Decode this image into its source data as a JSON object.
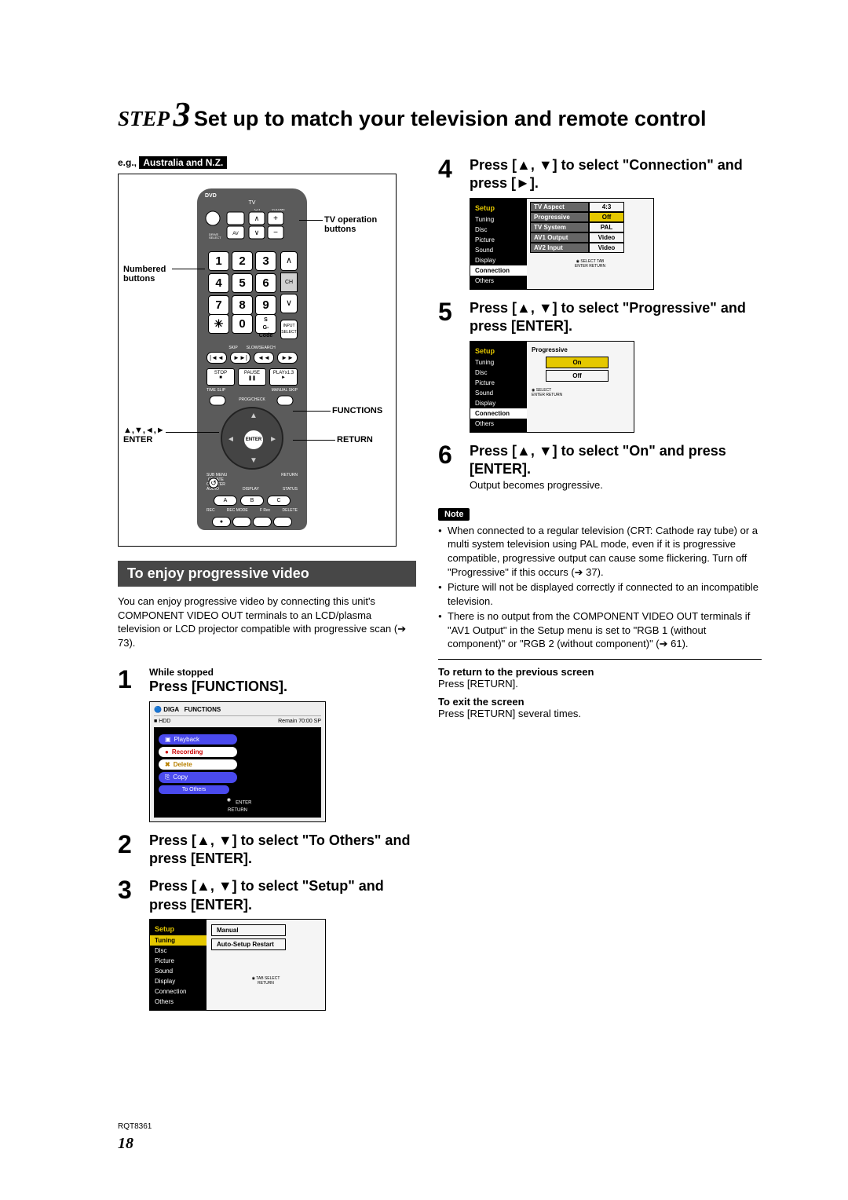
{
  "title": {
    "step_label": "STEP",
    "step_num": "3",
    "step_title": "Set up to match your television and remote control"
  },
  "eg": {
    "prefix": "e.g.,",
    "region": "Australia and N.Z."
  },
  "remote": {
    "dvd": "DVD",
    "tv": "TV",
    "keys": [
      "1",
      "2",
      "3",
      "4",
      "5",
      "6",
      "7",
      "8",
      "9"
    ],
    "zero": "0",
    "ch": "CH",
    "enter": "ENTER",
    "abc": [
      "A",
      "B",
      "C"
    ],
    "callouts": {
      "numbered": "Numbered buttons",
      "tvop": "TV operation buttons",
      "functions": "FUNCTIONS",
      "arrows": "▲,▼,◄,►\nENTER",
      "return": "RETURN"
    }
  },
  "section_bar": "To enjoy progressive video",
  "intro": "You can enjoy progressive video by connecting this unit's COMPONENT VIDEO OUT terminals to an LCD/plasma television or LCD projector compatible with progressive scan (➔ 73).",
  "steps": {
    "s1_small": "While stopped",
    "s1": "Press [FUNCTIONS].",
    "s2": "Press [▲, ▼] to select \"To Others\" and press [ENTER].",
    "s3": "Press [▲, ▼] to select \"Setup\" and press [ENTER].",
    "s4": "Press [▲, ▼] to select \"Connection\" and press [►].",
    "s5": "Press [▲, ▼] to select \"Progressive\" and press [ENTER].",
    "s6": "Press [▲, ▼] to select \"On\" and press [ENTER].",
    "s6_sub": "Output becomes progressive."
  },
  "menu1": {
    "brand": "DIGA",
    "functions": "FUNCTIONS",
    "hdd": "HDD",
    "remain": "Remain   70:00 SP",
    "items": [
      "Playback",
      "Recording",
      "Delete",
      "Copy",
      "To Others"
    ],
    "footer": "ENTER\nRETURN"
  },
  "setup1": {
    "title": "Setup",
    "tabs": [
      "Tuning",
      "Disc",
      "Picture",
      "Sound",
      "Display",
      "Connection",
      "Others"
    ],
    "opts": [
      "Manual",
      "Auto-Setup Restart"
    ],
    "hint": "TAB      SELECT\n          RETURN"
  },
  "setup2": {
    "title": "Setup",
    "tabs": [
      "Tuning",
      "Disc",
      "Picture",
      "Sound",
      "Display",
      "Connection",
      "Others"
    ],
    "rows": [
      {
        "k": "TV Aspect",
        "v": "4:3"
      },
      {
        "k": "Progressive",
        "v": "Off",
        "hl": true
      },
      {
        "k": "TV System",
        "v": "PAL"
      },
      {
        "k": "AV1 Output",
        "v": "Video"
      },
      {
        "k": "AV2 Input",
        "v": "Video"
      }
    ],
    "hint": "SELECT   TAB\nENTER    RETURN"
  },
  "setup3": {
    "title": "Setup",
    "tabs": [
      "Tuning",
      "Disc",
      "Picture",
      "Sound",
      "Display",
      "Connection",
      "Others"
    ],
    "prog_title": "Progressive",
    "opts": [
      "On",
      "Off"
    ],
    "hint": "SELECT\nENTER    RETURN"
  },
  "note_label": "Note",
  "notes": [
    "When connected to a regular television (CRT: Cathode ray tube) or a multi system television using PAL mode, even if it is progressive compatible, progressive output can cause some flickering. Turn off \"Progressive\" if this occurs (➔ 37).",
    "Picture will not be displayed correctly if connected to an incompatible television.",
    "There is no output from the COMPONENT VIDEO OUT terminals if \"AV1 Output\" in the Setup menu is set to \"RGB 1 (without component)\" or \"RGB 2 (without component)\" (➔ 61)."
  ],
  "return_prev_h": "To return to the previous screen",
  "return_prev": "Press [RETURN].",
  "exit_h": "To exit the screen",
  "exit": "Press [RETURN] several times.",
  "doc_code": "RQT8361",
  "page_num": "18"
}
